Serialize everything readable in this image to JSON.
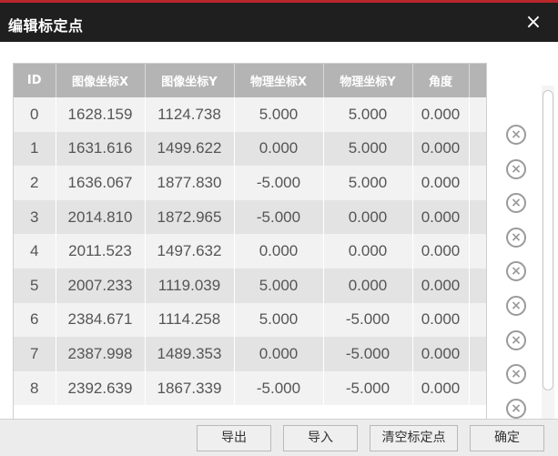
{
  "dialog": {
    "title": "编辑标定点",
    "close_icon": "×"
  },
  "table": {
    "headers": [
      "ID",
      "图像坐标X",
      "图像坐标Y",
      "物理坐标X",
      "物理坐标Y",
      "角度"
    ],
    "rows": [
      [
        "0",
        "1628.159",
        "1124.738",
        "5.000",
        "5.000",
        "0.000"
      ],
      [
        "1",
        "1631.616",
        "1499.622",
        "0.000",
        "5.000",
        "0.000"
      ],
      [
        "2",
        "1636.067",
        "1877.830",
        "-5.000",
        "5.000",
        "0.000"
      ],
      [
        "3",
        "2014.810",
        "1872.965",
        "-5.000",
        "0.000",
        "0.000"
      ],
      [
        "4",
        "2011.523",
        "1497.632",
        "0.000",
        "0.000",
        "0.000"
      ],
      [
        "5",
        "2007.233",
        "1119.039",
        "5.000",
        "0.000",
        "0.000"
      ],
      [
        "6",
        "2384.671",
        "1114.258",
        "5.000",
        "-5.000",
        "0.000"
      ],
      [
        "7",
        "2387.998",
        "1489.353",
        "0.000",
        "-5.000",
        "0.000"
      ],
      [
        "8",
        "2392.639",
        "1867.339",
        "-5.000",
        "-5.000",
        "0.000"
      ]
    ],
    "delete_icon": "×"
  },
  "footer": {
    "export_label": "导出",
    "import_label": "导入",
    "clear_label": "清空标定点",
    "confirm_label": "确定"
  }
}
